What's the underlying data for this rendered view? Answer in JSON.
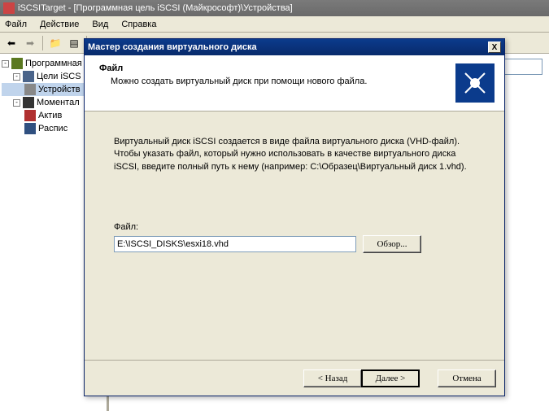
{
  "main_window": {
    "title": "iSCSITarget - [Программная цель iSCSI (Майкрософт)\\Устройства]"
  },
  "menu": {
    "file": "Файл",
    "action": "Действие",
    "view": "Вид",
    "help": "Справка"
  },
  "tree": {
    "root": "Программная",
    "targets": "Цели iSCS",
    "devices": "Устройств",
    "snapshots": "Моментал",
    "active": "Актив",
    "sched": "Распис"
  },
  "wizard": {
    "title": "Мастер создания виртуального диска",
    "close_x": "X",
    "header_title": "Файл",
    "header_sub": "Можно создать виртуальный диск при помощи нового файла.",
    "body_desc": "Виртуальный диск iSCSI создается в виде файла виртуального диска (VHD-файл). Чтобы указать файл, который нужно использовать в качестве виртуального диска iSCSI, введите полный путь к нему (например: C:\\Образец\\Виртуальный диск 1.vhd).",
    "file_label": "Файл:",
    "file_value": "E:\\ISCSI_DISKS\\esxi18.vhd",
    "browse": "Обзор...",
    "back": "< Назад",
    "next": "Далее >",
    "cancel": "Отмена"
  }
}
